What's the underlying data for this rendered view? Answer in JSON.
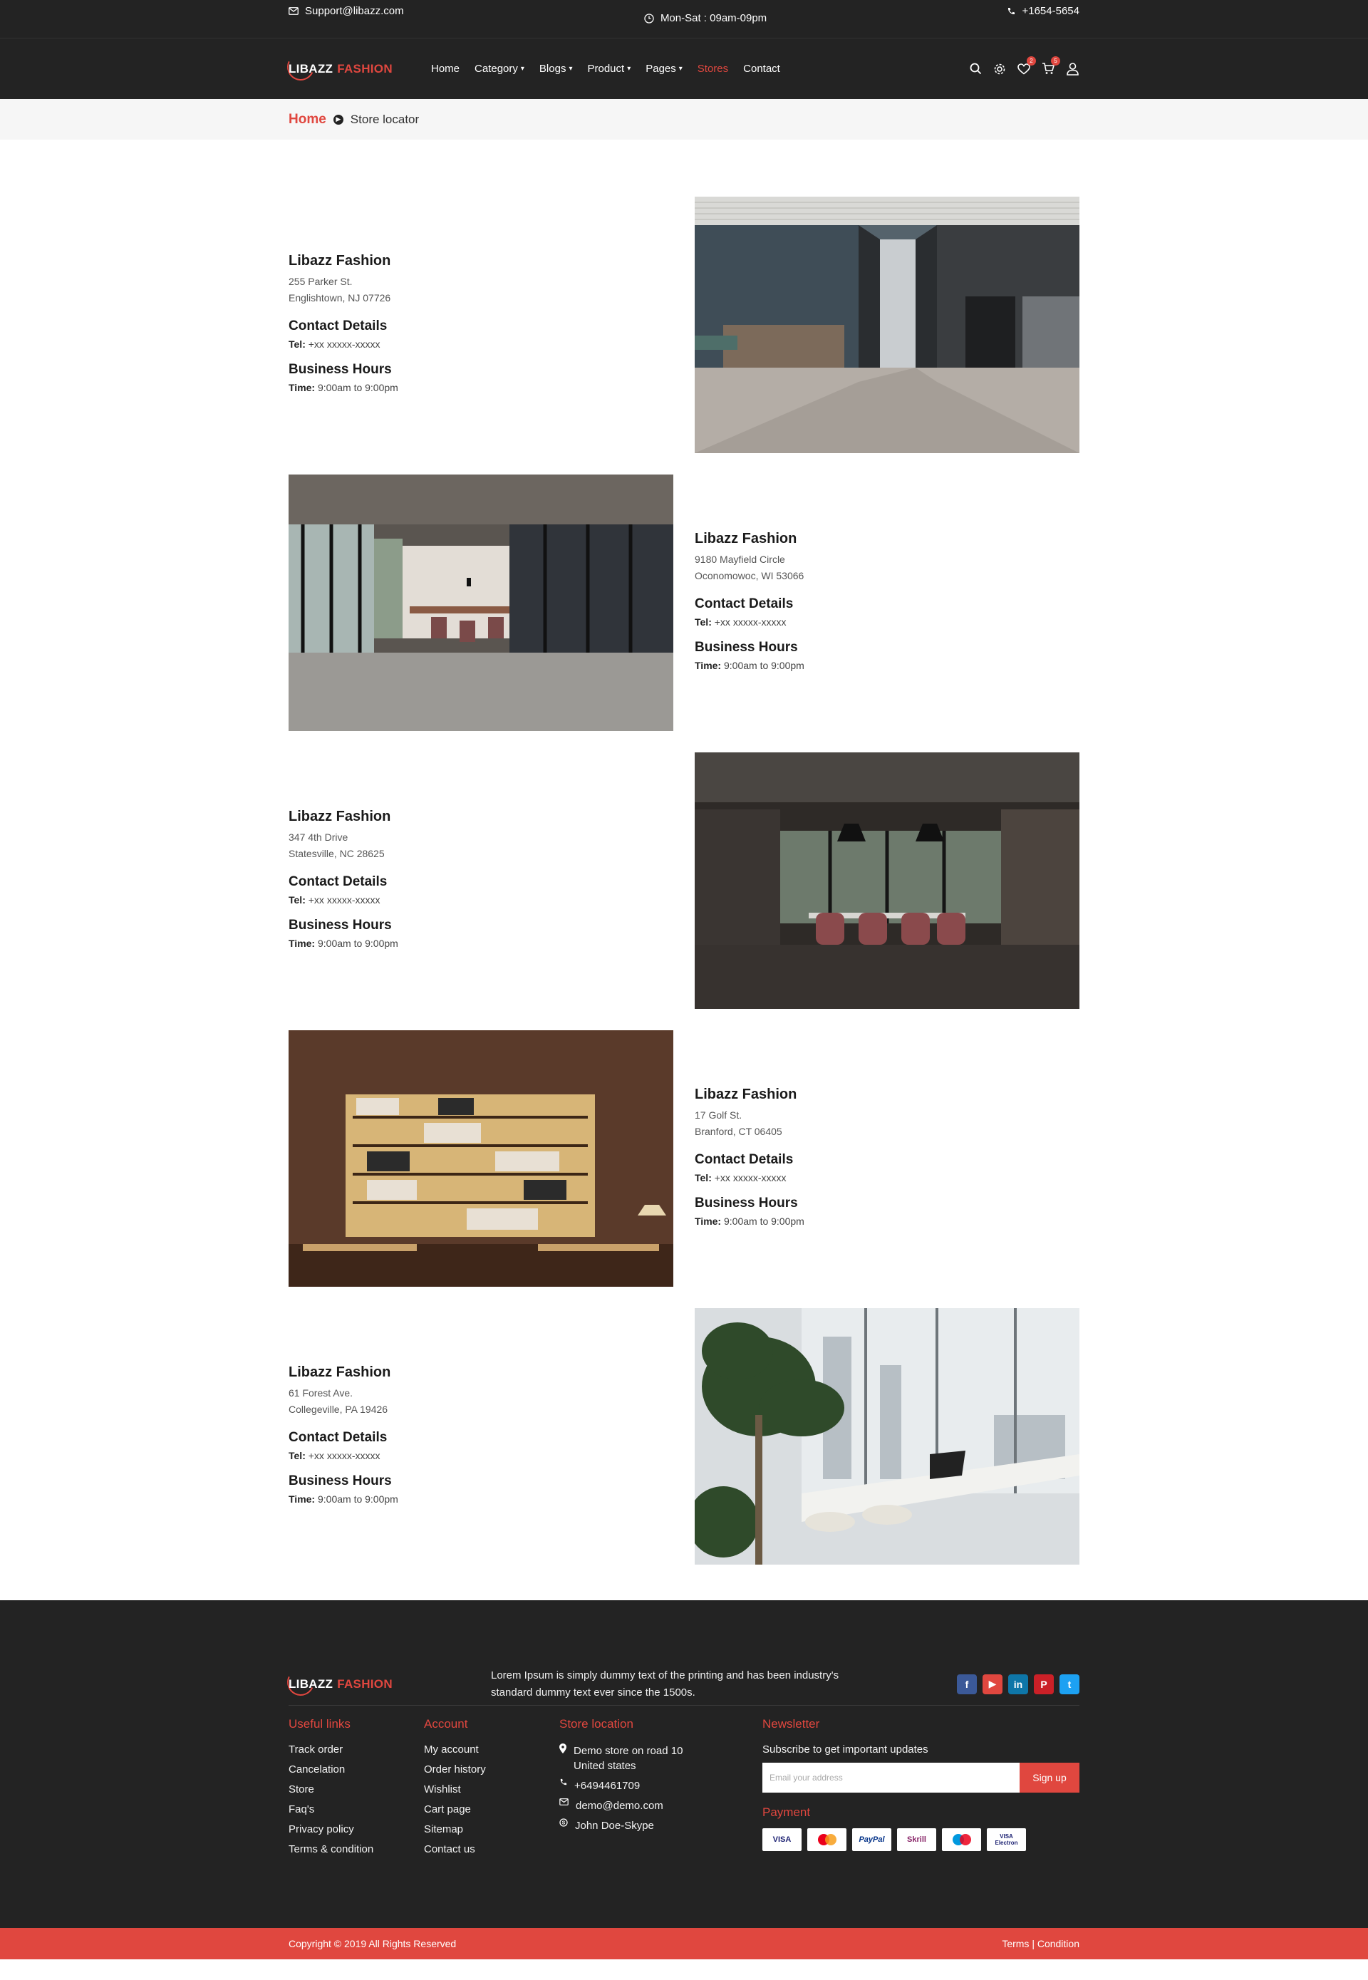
{
  "topbar": {
    "email": "Support@libazz.com",
    "hours": "Mon-Sat : 09am-09pm",
    "phone": "+1654-5654"
  },
  "brand": {
    "part1": "LIBAZZ",
    "part2": "FASHION",
    "accent": "#e0473f"
  },
  "nav": [
    {
      "label": "Home",
      "dropdown": false
    },
    {
      "label": "Category",
      "dropdown": true
    },
    {
      "label": "Blogs",
      "dropdown": true
    },
    {
      "label": "Product",
      "dropdown": true
    },
    {
      "label": "Pages",
      "dropdown": true
    },
    {
      "label": "Stores",
      "dropdown": false,
      "active": true
    },
    {
      "label": "Contact",
      "dropdown": false
    }
  ],
  "header_icons": {
    "wishlist_count": "2",
    "cart_count": "5"
  },
  "breadcrumb": {
    "home": "Home",
    "current": "Store locator"
  },
  "stores": [
    {
      "name": "Libazz Fashion",
      "street": "255 Parker St.",
      "city": "Englishtown, NJ 07726",
      "contact_heading": "Contact Details",
      "tel_label": "Tel:",
      "tel": "+xx xxxxx-xxxxx",
      "hours_heading": "Business Hours",
      "time_label": "Time:",
      "time": "9:00am to 9:00pm",
      "image": "office corridor"
    },
    {
      "name": "Libazz Fashion",
      "street": "9180 Mayfield Circle",
      "city": "Oconomowoc, WI 53066",
      "contact_heading": "Contact Details",
      "tel_label": "Tel:",
      "tel": "+xx xxxxx-xxxxx",
      "hours_heading": "Business Hours",
      "time_label": "Time:",
      "time": "9:00am to 9:00pm",
      "image": "loft meeting room"
    },
    {
      "name": "Libazz Fashion",
      "street": "347 4th Drive",
      "city": "Statesville, NC 28625",
      "contact_heading": "Contact Details",
      "tel_label": "Tel:",
      "tel": "+xx xxxxx-xxxxx",
      "hours_heading": "Business Hours",
      "time_label": "Time:",
      "time": "9:00am to 9:00pm",
      "image": "conference room"
    },
    {
      "name": "Libazz Fashion",
      "street": "17 Golf St.",
      "city": "Branford, CT 06405",
      "contact_heading": "Contact Details",
      "tel_label": "Tel:",
      "tel": "+xx xxxxx-xxxxx",
      "hours_heading": "Business Hours",
      "time_label": "Time:",
      "time": "9:00am to 9:00pm",
      "image": "library bookshelf"
    },
    {
      "name": "Libazz Fashion",
      "street": "61 Forest Ave.",
      "city": "Collegeville, PA 19426",
      "contact_heading": "Contact Details",
      "tel_label": "Tel:",
      "tel": "+xx xxxxx-xxxxx",
      "hours_heading": "Business Hours",
      "time_label": "Time:",
      "time": "9:00am to 9:00pm",
      "image": "window desk with plant"
    }
  ],
  "footer": {
    "about": "Lorem Ipsum is simply dummy text of the printing and has been industry's standard dummy text ever since the 1500s.",
    "socials": [
      {
        "name": "facebook-icon",
        "glyph": "f",
        "color": "#3b5998"
      },
      {
        "name": "youtube-icon",
        "glyph": "▶",
        "color": "#e0473f"
      },
      {
        "name": "linkedin-icon",
        "glyph": "in",
        "color": "#0e76a8"
      },
      {
        "name": "pinterest-icon",
        "glyph": "P",
        "color": "#cb2027"
      },
      {
        "name": "twitter-icon",
        "glyph": "t",
        "color": "#1da1f2"
      }
    ],
    "useful_title": "Useful links",
    "useful": [
      "Track order",
      "Cancelation",
      "Store",
      "Faq's",
      "Privacy policy",
      "Terms & condition"
    ],
    "account_title": "Account",
    "account": [
      "My account",
      "Order history",
      "Wishlist",
      "Cart page",
      "Sitemap",
      "Contact us"
    ],
    "location_title": "Store location",
    "address_line1": "Demo store on road 10",
    "address_line2": "United states",
    "phone": "+6494461709",
    "email": "demo@demo.com",
    "skype": "John Doe-Skype",
    "newsletter_title": "Newsletter",
    "newsletter_sub": "Subscribe to get important updates",
    "email_placeholder": "Email your address",
    "signup": "Sign up",
    "payment_title": "Payment",
    "cards": [
      {
        "label": "VISA",
        "color": "#1a1f71"
      },
      {
        "label": "Mastercard",
        "color": "#eb001b"
      },
      {
        "label": "PayPal",
        "color": "#003087"
      },
      {
        "label": "Skrill",
        "color": "#862165"
      },
      {
        "label": "Maestro",
        "color": "#0099df"
      },
      {
        "label": "VISA Electron",
        "color": "#1a1f71"
      }
    ]
  },
  "copyright": "Copyright © 2019 All Rights Reserved",
  "terms": "Terms | Condition"
}
